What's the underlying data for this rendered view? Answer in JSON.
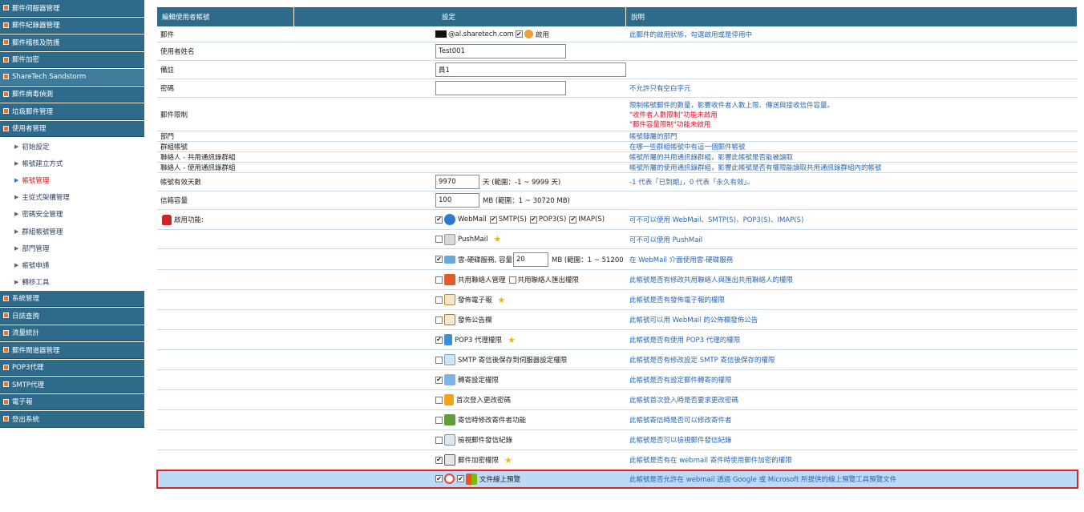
{
  "sidebar": {
    "top": [
      "郵件伺服器管理",
      "郵件紀錄器管理",
      "郵件稽核及防護",
      "郵件加密",
      "ShareTech Sandstorm",
      "郵件病毒偵測",
      "垃圾郵件管理",
      "使用者管理"
    ],
    "sub": [
      "初始設定",
      "帳號建立方式",
      "帳號管理",
      "主從式架構管理",
      "密碼安全管理",
      "群組帳號管理",
      "部門管理",
      "帳號申請",
      "轉移工具"
    ],
    "bottom": [
      "系統管理",
      "日誌查詢",
      "流量統計",
      "郵件閘道器管理",
      "POP3代理",
      "SMTP代理",
      "電子報",
      "登出系統"
    ]
  },
  "header": {
    "col1": "編輯使用者帳號",
    "col2": "設定",
    "col3": "說明"
  },
  "rows": {
    "email": {
      "label": "郵件",
      "domain": "@al.sharetech.com",
      "enable": "啟用",
      "desc": "此郵件的啟用狀態，勾選啟用或是停用中"
    },
    "username": {
      "label": "使用者姓名",
      "value": "Test001"
    },
    "note": {
      "label": "備註",
      "value": "員1"
    },
    "password": {
      "label": "密碼",
      "value": "",
      "desc": "不允許只有空白字元"
    },
    "limit": {
      "label": "郵件限制",
      "desc1": "限制帳號郵件的數量，影響收件者人數上限、傳送與接收信件容量。",
      "desc2": "\"收件者人數限制\"功能未啟用",
      "desc3": "\"郵件容量限制\"功能未啟用"
    },
    "dept": {
      "label": "部門",
      "desc": "帳號隸屬的部門"
    },
    "group": {
      "label": "群組帳號",
      "desc": "在哪一些群組帳號中有這一個郵件帳號"
    },
    "contact_shared": {
      "label": "聯絡人 - 共用通訊錄群組",
      "desc": "帳號所屬的共用通訊錄群組，影響此帳號是否能被讀取"
    },
    "contact_user": {
      "label": "聯絡人 - 使用通訊錄群組",
      "desc": "帳號所屬的使用通訊錄群組，影響此帳號是否有權限能讀取共用通訊錄群組內的帳號"
    },
    "days": {
      "label": "帳號有效天數",
      "value": "9970",
      "unit": "天 (範圍：-1 ~ 9999 天)",
      "desc": "-1 代表「已到期」，0 代表「永久有效」。"
    },
    "quota": {
      "label": "信箱容量",
      "value": "100",
      "unit": "MB (範圍：1 ~ 30720 MB)"
    },
    "features": {
      "label": "啟用功能:",
      "webmail": {
        "items": [
          "WebMail",
          "SMTP(S)",
          "POP3(S)",
          "IMAP(S)"
        ],
        "desc": "可不可以使用 WebMail、SMTP(S)、POP3(S)、IMAP(S)"
      },
      "pushmail": {
        "label": "PushMail",
        "desc": "可不可以使用 PushMail"
      },
      "cloud": {
        "label": "雲-硬碟服務, 容量",
        "value": "20",
        "unit": "MB (範圍：1 ~ 51200 MB)",
        "desc": "在 WebMail 介面使用雲-硬碟服務"
      },
      "shared_contacts": {
        "label": "共用聯絡人管理",
        "label2": "共用聯絡人匯出權限",
        "desc": "此帳號是否有修改共用聯絡人與匯出共用聯絡人的權限"
      },
      "newsletter": {
        "label": "發佈電子報",
        "desc": "此帳號是否有發佈電子報的權限"
      },
      "bulletin": {
        "label": "發佈公告欄",
        "desc": "此帳號可以用 WebMail 的公佈欄發佈公告"
      },
      "pop3proxy": {
        "label": "POP3 代理權限",
        "desc": "此帳號是否有使用 POP3 代理的權限"
      },
      "smtp_delay": {
        "label": "SMTP 寄信後保存到伺服器設定權限",
        "desc": "此帳號是否有修改設定 SMTP 寄信後保存的權限"
      },
      "forward": {
        "label": "轉寄設定權限",
        "desc": "此帳號是否有設定郵件轉寄的權限"
      },
      "first_login": {
        "label": "首次登入更改密碼",
        "desc": "此帳號首次登入時是否要求更改密碼"
      },
      "mod_recv": {
        "label": "寄信時修改寄件者功能",
        "desc": "此帳號寄信時是否可以修改寄件者"
      },
      "view_log": {
        "label": "檢視郵件發信紀錄",
        "desc": "此帳號是否可以檢視郵件發信紀錄"
      },
      "encrypt": {
        "label": "郵件加密權限",
        "desc": "此帳號是否有在 webmail 寄件時使用郵件加密的權限"
      },
      "online_view": {
        "label": "文件線上預覽",
        "desc": "此帳號是否允許在 webmail 透過 Google 或 Microsoft 所提供的線上預覽工具預覽文件"
      }
    }
  },
  "colors": {
    "header": "#2e6a8a",
    "accent": "#ff6a1f",
    "link": "#2a66b0",
    "alert": "#e0112b",
    "highlight": "#bcd9f5"
  }
}
